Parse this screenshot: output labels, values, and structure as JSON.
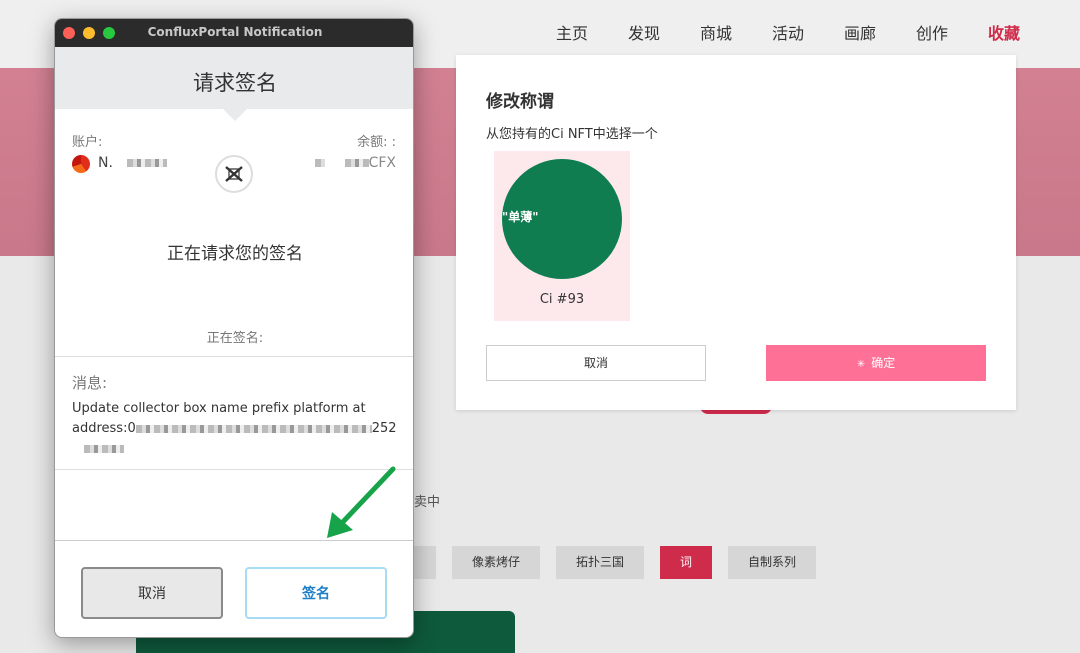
{
  "site": {
    "nav": [
      "主页",
      "发现",
      "商城",
      "活动",
      "画廊",
      "创作",
      "收藏"
    ],
    "active_nav": "收藏",
    "on_sale_text": "卖中",
    "tags": [
      "像素烤仔",
      "拓扑三国",
      "词",
      "自制系列"
    ]
  },
  "modal": {
    "title": "修改称谓",
    "subtitle": "从您持有的Ci NFT中选择一个",
    "nft": {
      "word": "\"单薄\"",
      "id": "Ci #93",
      "circle_color": "#0f7d50"
    },
    "cancel_label": "取消",
    "confirm_label": "确定",
    "confirm_color": "#ff7096"
  },
  "popup": {
    "window_title": "ConfluxPortal Notification",
    "header": "请求签名",
    "account_label": "账户:",
    "balance_label": "余额: :",
    "account_name_prefix": "N.",
    "balance_suffix": "CFX",
    "center_icon": "wallet-icon",
    "requesting_text": "正在请求您的签名",
    "signing_text": "正在签名:",
    "message_label": "消息:",
    "message_line1": "Update collector box name prefix platform at",
    "message_line2_prefix": "address:0",
    "message_line2_suffix": "252",
    "cancel_label": "取消",
    "sign_label": "签名"
  },
  "annotation": {
    "arrow_color": "#17a34a"
  }
}
